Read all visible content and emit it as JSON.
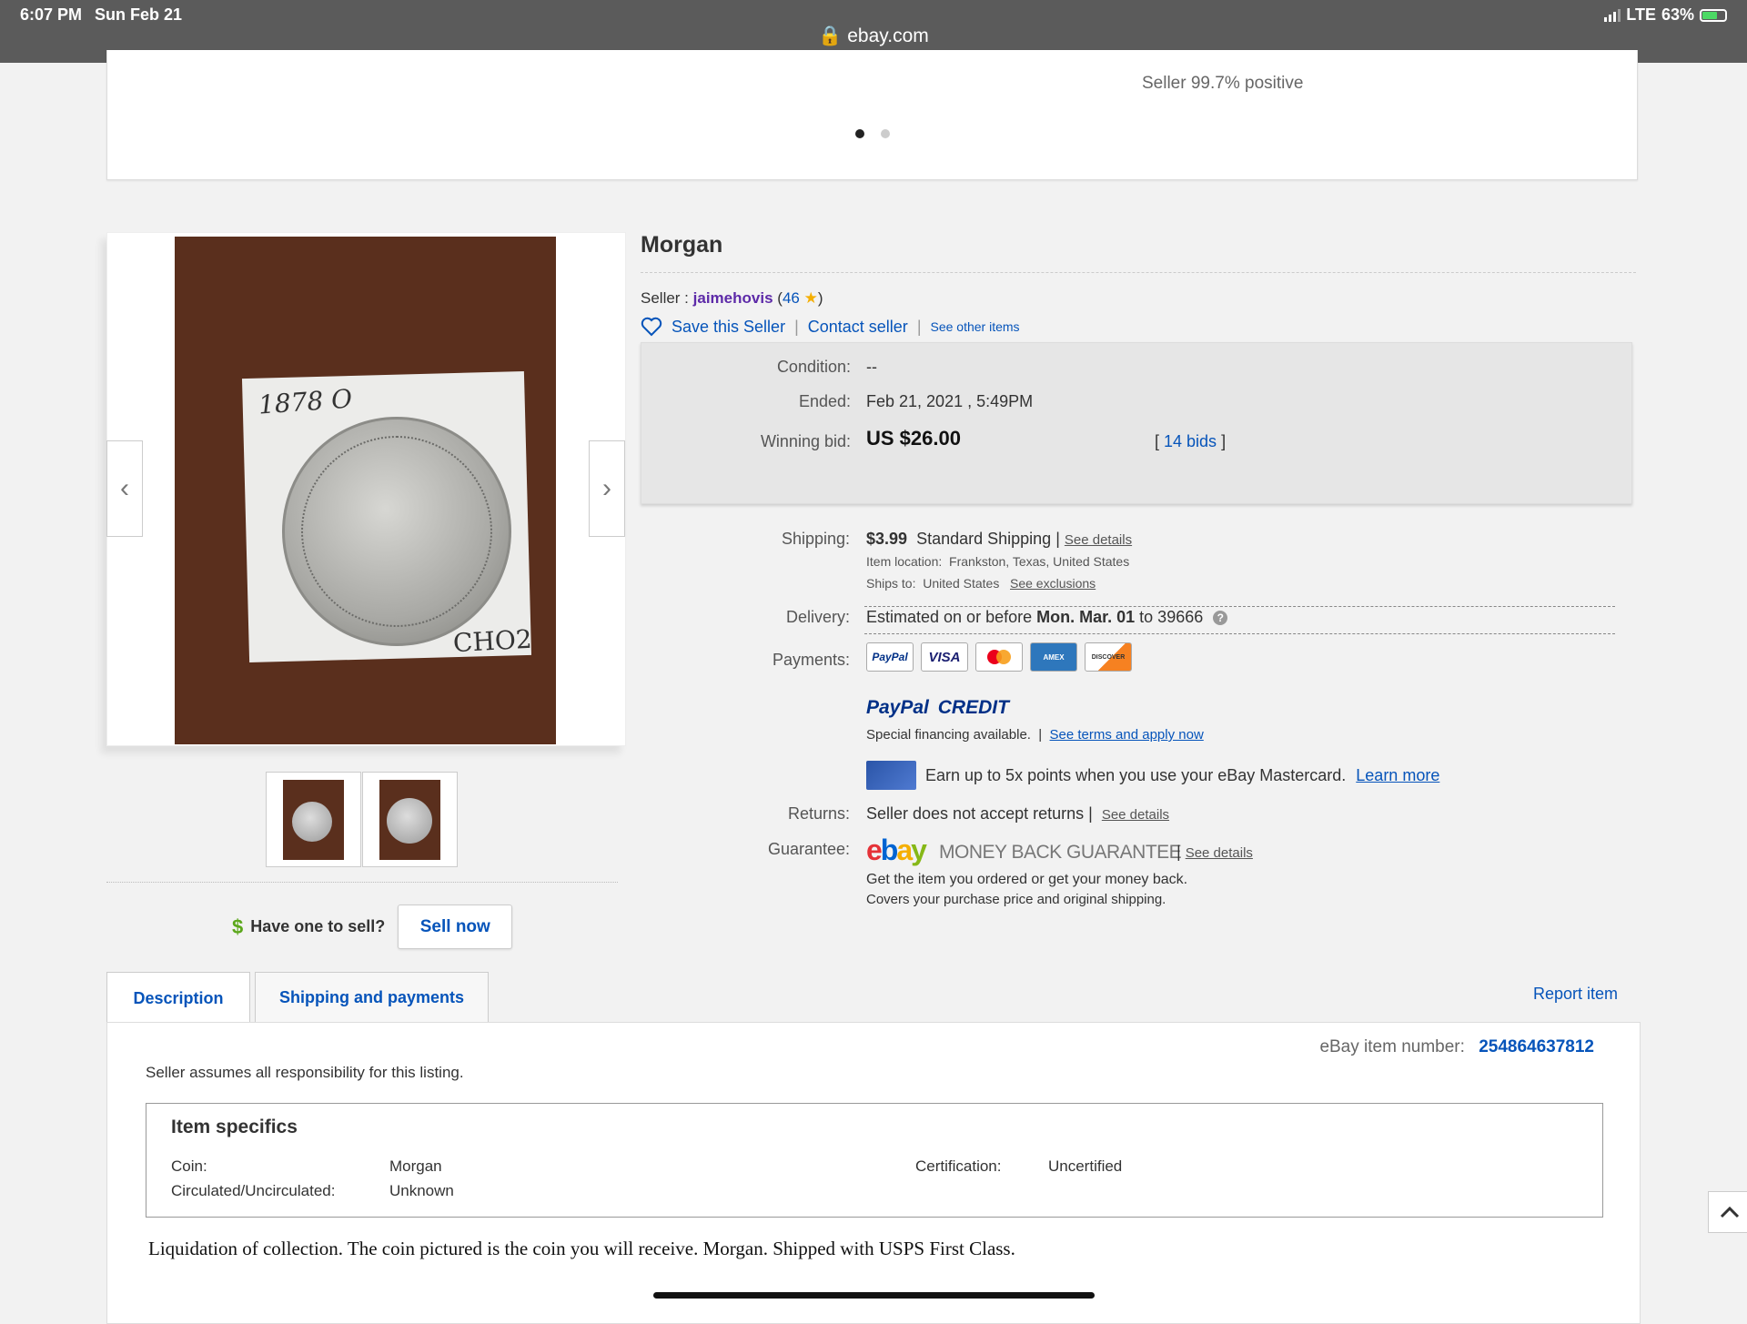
{
  "status_bar": {
    "time": "6:07 PM",
    "date": "Sun Feb 21",
    "network": "LTE",
    "battery": "63%",
    "url": "ebay.com"
  },
  "top_card": {
    "seller_rating": "Seller 99.7% positive"
  },
  "gallery": {
    "main_image_note_top": "1878 O",
    "main_image_note_bottom": "CHO2"
  },
  "item": {
    "title": "Morgan",
    "seller_prefix": "Seller :",
    "seller_name": "jaimehovis",
    "seller_score": "46",
    "save_seller": "Save this Seller",
    "contact_seller": "Contact seller",
    "see_other_items": "See other items"
  },
  "bid": {
    "condition_label": "Condition:",
    "condition_value": "--",
    "ended_label": "Ended:",
    "ended_value": "Feb 21, 2021 , 5:49PM",
    "winning_label": "Winning bid:",
    "winning_value": "US $26.00",
    "bids_link": "14 bids"
  },
  "shipping": {
    "label": "Shipping:",
    "price": "$3.99",
    "method": "Standard Shipping",
    "see_details": "See details",
    "location_label": "Item location:",
    "location_value": "Frankston, Texas, United States",
    "ships_to_label": "Ships to:",
    "ships_to_value": "United States",
    "see_exclusions": "See exclusions"
  },
  "delivery": {
    "label": "Delivery:",
    "prefix": "Estimated on or before",
    "date": "Mon. Mar. 01",
    "suffix": "to 39666"
  },
  "payments": {
    "label": "Payments:",
    "logos": [
      "PayPal",
      "VISA",
      "MC",
      "AMEX",
      "DISCOVER"
    ],
    "paypal_credit_1": "PayPal",
    "paypal_credit_2": "CREDIT",
    "financing": "Special financing available.",
    "financing_link": "See terms and apply now",
    "mastercard_text": "Earn up to 5x points when you use your eBay Mastercard.",
    "learn_more": "Learn more"
  },
  "returns": {
    "label": "Returns:",
    "value": "Seller does not accept returns",
    "see_details": "See details"
  },
  "guarantee": {
    "label": "Guarantee:",
    "mbg_text": "MONEY BACK GUARANTEE",
    "see_details": "See details",
    "line1": "Get the item you ordered or get your money back.",
    "line2": "Covers your purchase price and original shipping."
  },
  "sell": {
    "question": "Have one to sell?",
    "button": "Sell now"
  },
  "tabs": {
    "description": "Description",
    "shipping": "Shipping and payments",
    "report": "Report item"
  },
  "description": {
    "item_number_label": "eBay item number:",
    "item_number": "254864637812",
    "responsibility": "Seller assumes all responsibility for this listing.",
    "specifics_title": "Item specifics",
    "coin_label": "Coin:",
    "coin_value": "Morgan",
    "circ_label": "Circulated/Uncirculated:",
    "circ_value": "Unknown",
    "cert_label": "Certification:",
    "cert_value": "Uncertified",
    "text": "Liquidation of collection. The coin pictured is the coin you will receive. Morgan. Shipped with USPS First Class."
  }
}
